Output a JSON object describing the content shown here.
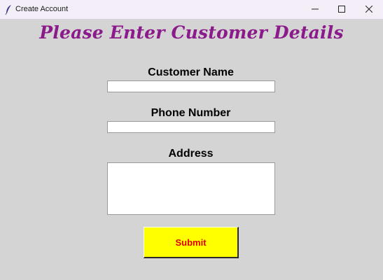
{
  "window": {
    "title": "Create Account",
    "app_icon": "feather-icon",
    "controls": {
      "minimize_icon": "minimize-icon",
      "maximize_icon": "maximize-icon",
      "close_icon": "close-icon"
    }
  },
  "form": {
    "heading": "Please Enter Customer Details",
    "heading_color": "#8b1a8b",
    "customer_name": {
      "label": "Customer Name",
      "value": ""
    },
    "phone_number": {
      "label": "Phone Number",
      "value": ""
    },
    "address": {
      "label": "Address",
      "value": ""
    },
    "submit": {
      "label": "Submit",
      "background": "#ffff00",
      "text_color": "#e00000"
    }
  },
  "colors": {
    "window_background": "#d4d4d4",
    "titlebar_background": "#f3eef7"
  }
}
